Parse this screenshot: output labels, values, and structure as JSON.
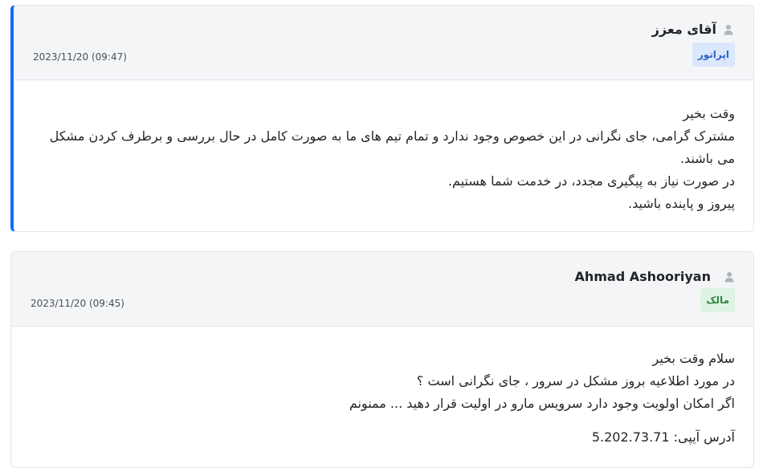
{
  "messages": [
    {
      "author": "آقای معزز",
      "role": "اپراتور",
      "timestamp": "2023/11/20 (09:47)",
      "lines": [
        "وقت بخیر",
        "مشترک گرامی، جای نگرانی در این خصوص وجود ندارد و تمام تیم های ما به صورت کامل در حال بررسی و برطرف کردن مشکل می باشند.",
        "در صورت نیاز به پیگیری مجدد، در خدمت شما هستیم.",
        "پیروز و پاینده باشید."
      ]
    },
    {
      "author": "Ahmad Ashooriyan",
      "role": "مالک",
      "timestamp": "2023/11/20 (09:45)",
      "lines": [
        "سلام وقت بخیر",
        "در مورد اطلاعیه بروز مشکل در سرور ، جای نگرانی است ؟",
        "اگر امکان اولویت وجود دارد سرویس مارو در اولیت قرار دهید ... ممنونم"
      ],
      "ip_label": "آدرس آیپی: 5.202.73.71"
    }
  ],
  "icons": {
    "author": "user-icon"
  },
  "colors": {
    "operator_accent": "#0d6efd",
    "operator_badge_bg": "#dbe7fb",
    "operator_badge_text": "#2d64c8",
    "owner_badge_bg": "#dff3e4",
    "owner_badge_text": "#2f8a47",
    "header_bg": "#f4f5f7"
  }
}
